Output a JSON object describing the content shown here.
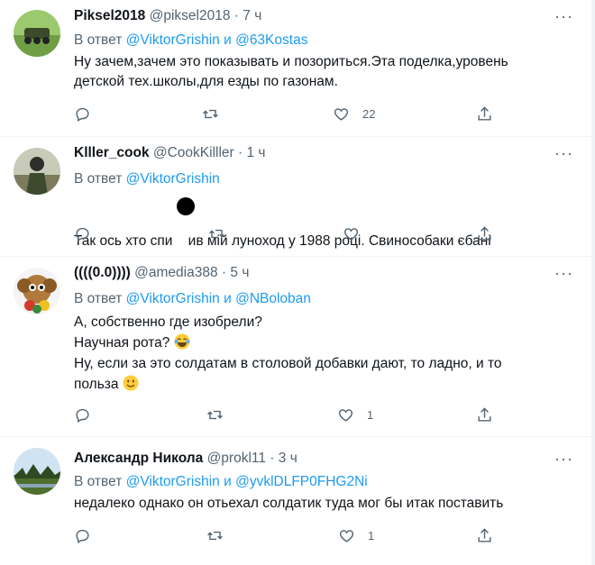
{
  "tweets": [
    {
      "name": "Piksel2018",
      "handle": "@piksel2018",
      "dot": "·",
      "time": "7 ч",
      "reply_prefix": "В ответ",
      "mentions": [
        "@ViktorGrishin",
        "@63Kostas"
      ],
      "conj": "и",
      "lines": [
        "Ну зачем,зачем это показывать и позориться.Эта поделка,уровень",
        "детской тех.школы,для езды по газонам."
      ],
      "likes": "22"
    },
    {
      "name": "Klller_cook",
      "handle": "@CookKilller",
      "dot": "·",
      "time": "1 ч",
      "reply_prefix": "В ответ",
      "mentions": [
        "@ViktorGrishin"
      ],
      "lines": [
        "Так ось хто спи    ив мій луноход у 1988 році. Свинособаки єбані"
      ],
      "likes": ""
    },
    {
      "name": "((((0.0))))",
      "handle": "@amedia388",
      "dot": "·",
      "time": "5 ч",
      "reply_prefix": "В ответ",
      "mentions": [
        "@ViktorGrishin",
        "@NBoloban"
      ],
      "conj": "и",
      "lines": [
        "А, собственно где изобрели?",
        "Научная рота?",
        "Ну, если за это солдатам в столовой добавки дают, то ладно, и то",
        "польза"
      ],
      "likes": "1"
    },
    {
      "name": "Александр Никола",
      "handle": "@prokl11",
      "dot": "·",
      "time": "3 ч",
      "reply_prefix": "В ответ",
      "mentions": [
        "@ViktorGrishin",
        "@yvklDLFP0FHG2Ni"
      ],
      "conj": "и",
      "lines": [
        "недалеко однако он отьехал солдатик туда мог бы итак поставить"
      ],
      "likes": "1"
    }
  ],
  "more_glyph": "···",
  "colors": {
    "accent": "#1d9bf0",
    "muted": "#536471",
    "text": "#0f1419",
    "divider": "#eff3f4"
  },
  "icons": [
    "reply-icon",
    "retweet-icon",
    "like-icon",
    "share-icon",
    "more-icon"
  ]
}
